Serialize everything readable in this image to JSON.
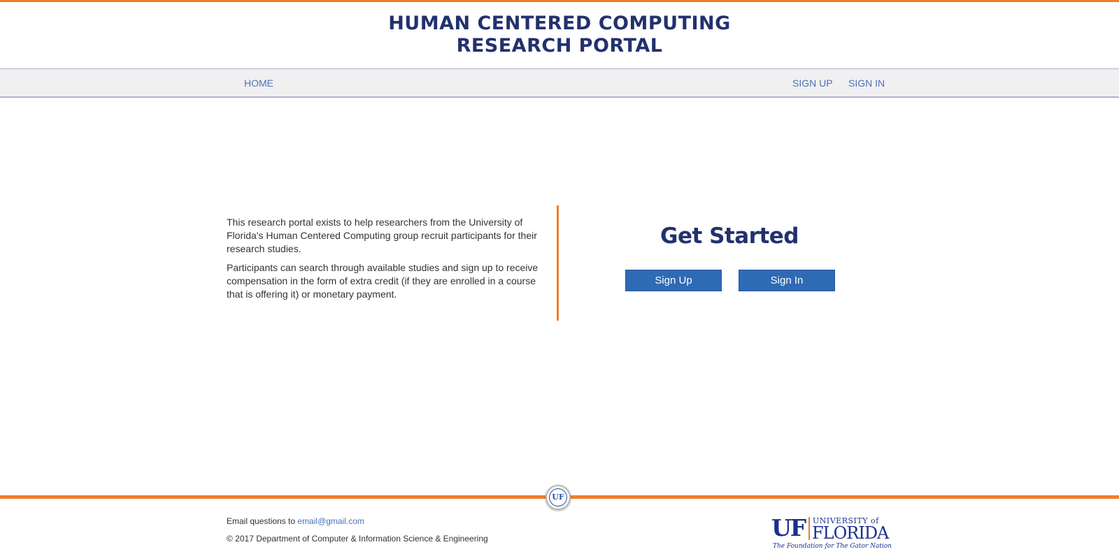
{
  "header": {
    "title_line1": "HUMAN CENTERED COMPUTING",
    "title_line2": "RESEARCH PORTAL",
    "accent_color": "#f07d2c",
    "title_color": "#22316e"
  },
  "nav": {
    "home": "HOME",
    "sign_up": "SIGN UP",
    "sign_in": "SIGN IN"
  },
  "main": {
    "intro_p1": "This research portal exists to help researchers from the University of Florida's Human Centered Computing group recruit participants for their research studies.",
    "intro_p2": "Participants can search through available studies and sign up to receive compensation in the form of extra credit (if they are enrolled in a course that is offering it) or monetary payment.",
    "get_started": "Get Started",
    "sign_up_button": "Sign Up",
    "sign_in_button": "Sign In",
    "button_color": "#2f6ab5"
  },
  "footer": {
    "email_prefix": "Email questions to ",
    "email": "email@gmail.com",
    "copyright": "© 2017 Department of Computer & Information Science & Engineering",
    "seal_text": "UF",
    "logo": {
      "uf": "UF",
      "university_of": "UNIVERSITY of",
      "florida": "FLORIDA",
      "tagline": "The Foundation for The Gator Nation"
    }
  }
}
